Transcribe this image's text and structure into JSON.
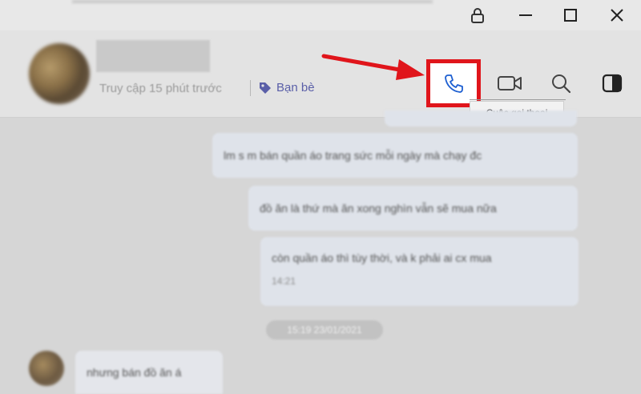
{
  "window": {
    "controls": [
      "lock-icon",
      "minimize-icon",
      "maximize-icon",
      "close-icon"
    ]
  },
  "contact": {
    "last_seen": "Truy cập 15 phút trước",
    "tag": "Bạn bè"
  },
  "header_actions": {
    "icons": [
      "phone-icon",
      "video-icon",
      "search-icon",
      "sidebar-toggle-icon"
    ]
  },
  "tooltip": {
    "text": "Cuộc gọi thoại"
  },
  "messages": [
    {
      "text": "lm s m bán quần áo trang sức mỗi ngày mà chạy đc"
    },
    {
      "text": "đồ ăn là thứ mà ăn xong nghìn vẫn sẽ mua nữa"
    },
    {
      "text": "còn quần áo thì tùy thời, và k phải ai cx mua",
      "time": "14:21"
    }
  ],
  "date_divider": "15:19 23/01/2021",
  "incoming_message": "nhưng bán đồ ăn á",
  "colors": {
    "highlight": "#e0151b",
    "accent": "#5a5fa8",
    "bubble": "#dfe3ea"
  }
}
